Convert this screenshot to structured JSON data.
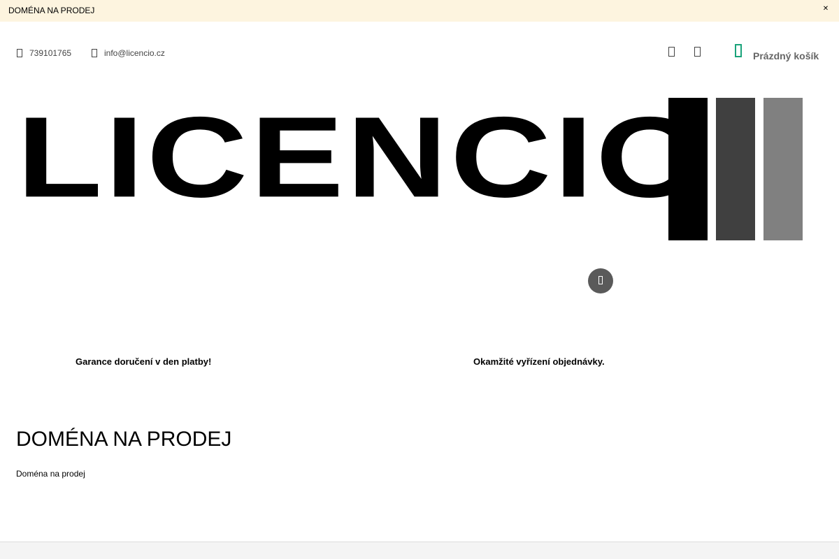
{
  "announcement": {
    "text": "DOMÉNA NA PRODEJ"
  },
  "header": {
    "phone": "739101765",
    "email": "info@licencio.cz",
    "cart_label": "Prázdný košík"
  },
  "logo": {
    "text": "LICENCIO"
  },
  "benefits": [
    {
      "text": "Garance doručení v den platby!"
    },
    {
      "text": "Okamžité vyřízení objednávky."
    }
  ],
  "content": {
    "title": "DOMÉNA NA PRODEJ",
    "text": "Doména na prodej"
  },
  "colors": {
    "accent": "#1aa37a",
    "announcement_bg": "#fdf4df"
  },
  "icons": [
    "close-icon",
    "phone-icon",
    "email-icon",
    "search-icon",
    "user-icon",
    "cart-icon",
    "slider-icon"
  ]
}
